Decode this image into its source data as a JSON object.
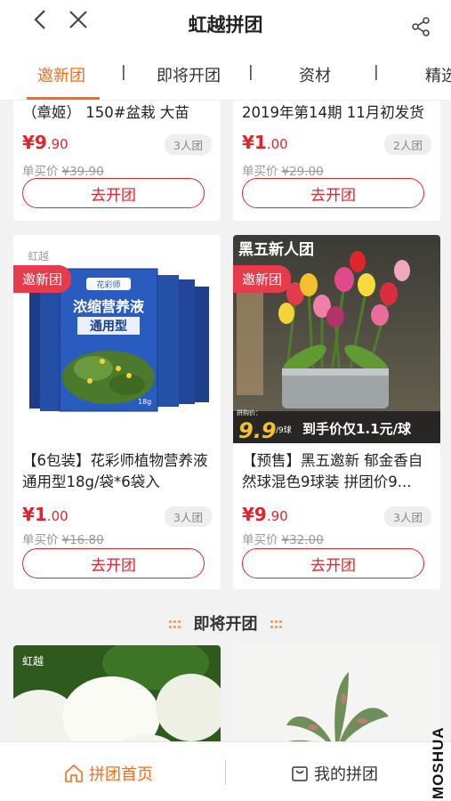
{
  "header": {
    "title": "虹越拼团"
  },
  "tabs": [
    {
      "label": "邀新团"
    },
    {
      "label": "即将开团"
    },
    {
      "label": "资材"
    },
    {
      "label": "精选"
    }
  ],
  "tab_separator": "|",
  "products": [
    {
      "name": "（章姬） 150#盆栽 大苗",
      "price_int": "¥9",
      "price_dec": ".90",
      "group": "3人团",
      "single_label": "单买价",
      "single_price": "¥39.90",
      "button": "去开团"
    },
    {
      "name": "2019年第14期 11月初发货",
      "price_int": "¥1",
      "price_dec": ".00",
      "group": "2人团",
      "single_label": "单买价",
      "single_price": "¥29.00",
      "button": "去开团"
    },
    {
      "badge": "邀新团",
      "name": "【6包装】花彩师植物营养液通用型18g/袋*6袋入",
      "price_int": "¥1",
      "price_dec": ".00",
      "group": "3人团",
      "single_label": "单买价",
      "single_price": "¥16.80",
      "button": "去开团",
      "image_text": {
        "logo": "虹越",
        "bag_brand": "花彩师",
        "bag_title": "浓缩营养液",
        "bag_sub": "通用型",
        "bag_weight": "18g"
      }
    },
    {
      "badge": "邀新团",
      "name": "【预售】黑五邀新 郁金香自然球混色9球装 拼团价9...",
      "price_int": "¥9",
      "price_dec": ".90",
      "group": "3人团",
      "single_label": "单买价",
      "single_price": "¥32.00",
      "button": "去开团",
      "image_text": {
        "banner": "黑五新人团",
        "promo_label": "拼购价：",
        "promo_price": "9.9",
        "promo_unit": "/9球",
        "promo_slogan": "到手价仅1.1元/球"
      }
    }
  ],
  "section": {
    "title": "即将开团"
  },
  "upcoming": [
    {
      "image_logo": "虹越"
    },
    {
      "image_logo": ""
    }
  ],
  "bottom_nav": {
    "home": "拼团首页",
    "mine": "我的拼团"
  },
  "watermark": "MOSHUA",
  "colors": {
    "accent": "#ff6a1a",
    "price": "#e0242c",
    "badge": "#e63b4a"
  }
}
